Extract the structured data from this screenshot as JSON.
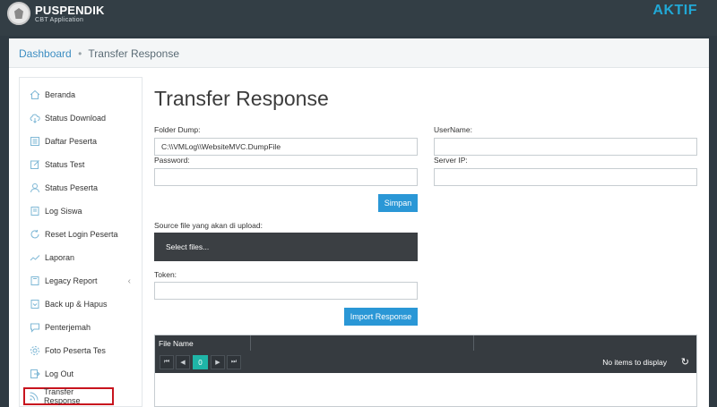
{
  "header": {
    "app_title": "PUSPENDIK",
    "app_subtitle": "CBT Application",
    "status": "AKTIF"
  },
  "breadcrumb": {
    "home": "Dashboard",
    "separator": "•",
    "current": "Transfer Response"
  },
  "sidebar": {
    "items": [
      {
        "label": "Beranda",
        "icon": "home-icon"
      },
      {
        "label": "Status Download",
        "icon": "cloud-download-icon"
      },
      {
        "label": "Daftar Peserta",
        "icon": "list-icon"
      },
      {
        "label": "Status Test",
        "icon": "edit-icon"
      },
      {
        "label": "Status Peserta",
        "icon": "user-icon"
      },
      {
        "label": "Log Siswa",
        "icon": "log-icon"
      },
      {
        "label": "Reset Login Peserta",
        "icon": "refresh-icon"
      },
      {
        "label": "Laporan",
        "icon": "chart-icon"
      },
      {
        "label": "Legacy Report",
        "icon": "report-icon",
        "chevron": "‹"
      },
      {
        "label": "Back up & Hapus",
        "icon": "backup-icon"
      },
      {
        "label": "Penterjemah",
        "icon": "chat-icon"
      },
      {
        "label": "Foto Peserta Tes",
        "icon": "gear-icon"
      },
      {
        "label": "Log Out",
        "icon": "logout-icon"
      },
      {
        "label": "Transfer Response",
        "icon": "rss-icon",
        "active": true
      }
    ]
  },
  "main": {
    "title": "Transfer Response",
    "form": {
      "folder_dump_label": "Folder Dump:",
      "folder_dump_value": "C:\\\\VMLog\\\\WebsiteMVC.DumpFile",
      "username_label": "UserName:",
      "username_value": "",
      "password_label": "Password:",
      "password_value": "",
      "server_ip_label": "Server IP:",
      "server_ip_value": "",
      "save_button": "Simpan",
      "source_file_label": "Source file yang akan di upload:",
      "select_files_button": "Select files...",
      "token_label": "Token:",
      "token_value": "",
      "import_button": "Import Response"
    },
    "grid": {
      "columns": [
        "File Name",
        "",
        ""
      ],
      "pager": {
        "first": "⏮",
        "prev": "◀",
        "current_page": "0",
        "next": "▶",
        "last": "⏭",
        "info": "No items to display",
        "refresh": "↻"
      }
    }
  },
  "colors": {
    "topbar": "#333e45",
    "accent": "#2a97d6",
    "status": "#21a8d6",
    "active_outline": "#c8141e",
    "grid_header": "#363b40",
    "pager_active": "#1fb5a7"
  }
}
